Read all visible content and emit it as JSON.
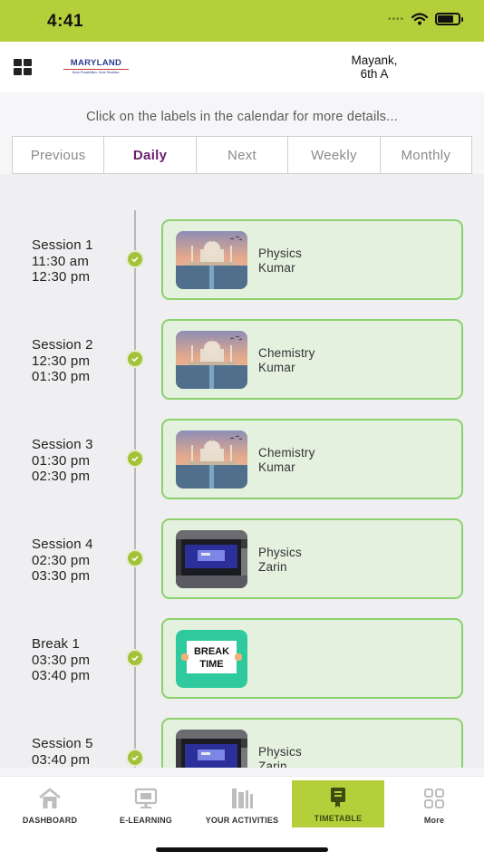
{
  "status_bar": {
    "time": "4:41",
    "icons": [
      "cellular-dots-icon",
      "wifi-icon",
      "battery-icon"
    ],
    "color": "#b5cf3a"
  },
  "header": {
    "menu_icon": "grid-menu-icon",
    "logo_name": "MARYLAND",
    "logo_tagline": "More Possibilities. More Realities.",
    "user_name": "Mayank,",
    "user_class": "6th A"
  },
  "hint_text": "Click on the labels in the calendar for more details...",
  "tabs": [
    "Previous",
    "Daily",
    "Next",
    "Weekly",
    "Monthly"
  ],
  "active_tab": "Daily",
  "sessions": [
    {
      "title": "Session 1",
      "start": "11:30 am",
      "end": "12:30 pm",
      "subject": "Physics",
      "teacher": "Kumar",
      "thumbnail": "taj-mahal-image"
    },
    {
      "title": "Session 2",
      "start": "12:30 pm",
      "end": "01:30 pm",
      "subject": "Chemistry",
      "teacher": "Kumar",
      "thumbnail": "taj-mahal-image"
    },
    {
      "title": "Session 3",
      "start": "01:30 pm",
      "end": "02:30 pm",
      "subject": "Chemistry",
      "teacher": "Kumar",
      "thumbnail": "taj-mahal-image"
    },
    {
      "title": "Session 4",
      "start": "02:30 pm",
      "end": "03:30 pm",
      "subject": "Physics",
      "teacher": "Zarin",
      "thumbnail": "laptop-screen-image"
    },
    {
      "title": "Break 1",
      "start": "03:30 pm",
      "end": "03:40 pm",
      "subject": "",
      "teacher": "",
      "thumbnail": "break-time-image",
      "thumbnail_text": "BREAK TIME"
    },
    {
      "title": "Session 5",
      "start": "03:40 pm",
      "end": "",
      "subject": "Physics",
      "teacher": "Zarin",
      "thumbnail": "laptop-screen-image"
    }
  ],
  "colors": {
    "accent": "#b5cf3a",
    "card_bg": "#e4f1df",
    "card_border": "#8bd16c",
    "active_tab_text": "#6a1f6d",
    "timeline_dot": "#a2c23a"
  },
  "tab_bar": [
    {
      "label": "DASHBOARD",
      "icon": "home-icon",
      "active": false
    },
    {
      "label": "E-LEARNING",
      "icon": "monitor-icon",
      "active": false
    },
    {
      "label": "YOUR ACTIVITIES",
      "icon": "activities-icon",
      "active": false
    },
    {
      "label": "TIMETABLE",
      "icon": "book-icon",
      "active": true
    },
    {
      "label": "More",
      "icon": "more-grid-icon",
      "active": false
    }
  ]
}
